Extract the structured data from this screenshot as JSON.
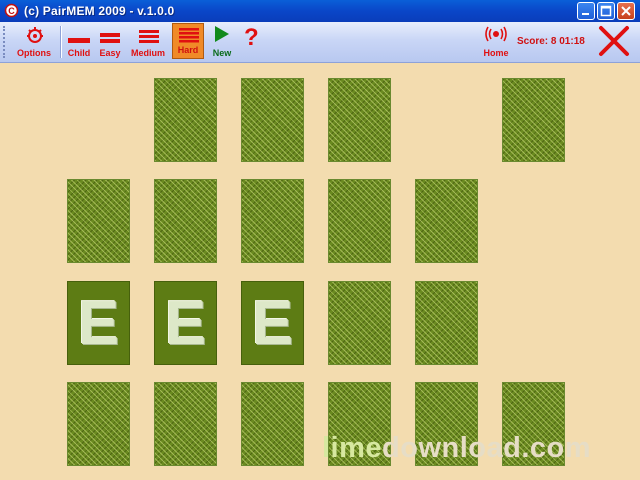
{
  "window": {
    "title": "(c) PairMEM 2009 - v.1.0.0"
  },
  "toolbar": {
    "options_label": "Options",
    "child_label": "Child",
    "easy_label": "Easy",
    "medium_label": "Medium",
    "hard_label": "Hard",
    "new_label": "New",
    "help_label": "?",
    "home_label": "Home",
    "score_text": "Score: 8  01:18",
    "selected_level": "Hard"
  },
  "board": {
    "rows": [
      [
        null,
        "back",
        "back",
        "back",
        null,
        "back"
      ],
      [
        "back",
        "back",
        "back",
        "back",
        "back",
        null
      ],
      [
        "E",
        "E",
        "E",
        "back",
        "back",
        null
      ],
      [
        "back",
        "back",
        "back",
        "back",
        "back",
        "back"
      ]
    ]
  },
  "watermark": {
    "part1": "lime",
    "part2": "download.com"
  },
  "colors": {
    "background": "#f3dcaf",
    "card_back": "#6a8a20",
    "card_face": "#5d7c14",
    "toolbar_text": "#e01010",
    "selected_level": "#f08a28"
  }
}
